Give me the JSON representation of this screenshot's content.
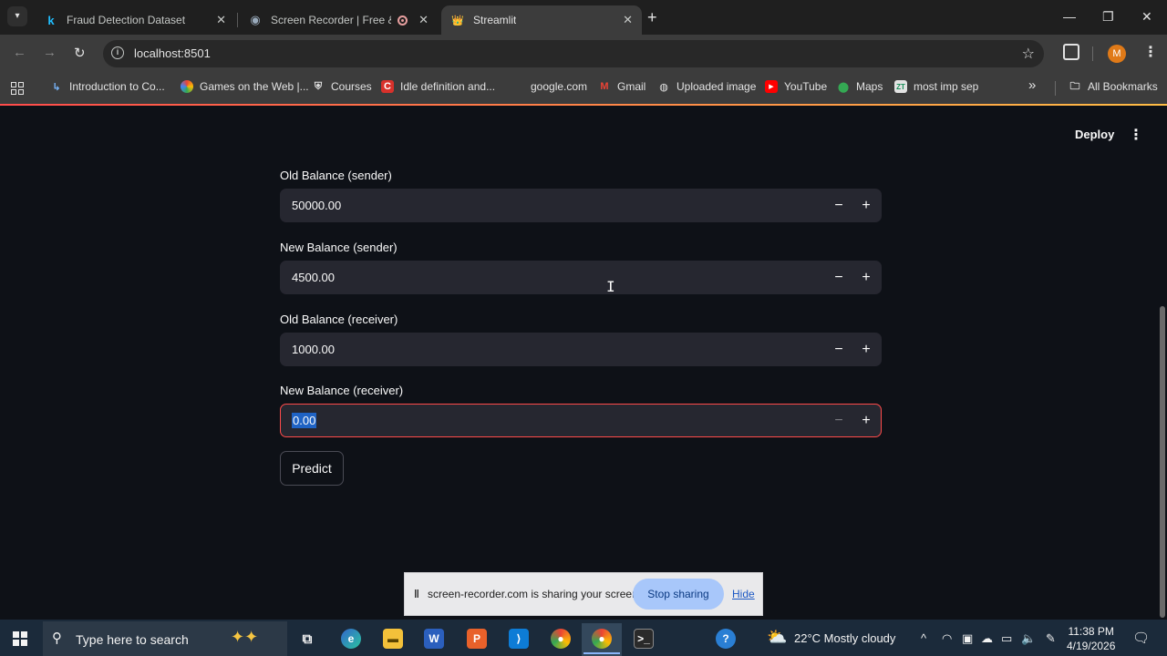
{
  "browser": {
    "tabs": [
      {
        "title": "Fraud Detection Dataset",
        "icon": "kaggle-icon"
      },
      {
        "title": "Screen Recorder | Free & O",
        "icon": "screen-recorder-icon"
      },
      {
        "title": "Streamlit",
        "icon": "streamlit-icon"
      }
    ],
    "url": "localhost:8501",
    "profile_initial": "M",
    "bookmarks": [
      "Introduction to Co...",
      "Games on the Web |...",
      "Courses",
      "Idle definition and...",
      "google.com",
      "Gmail",
      "Uploaded image",
      "YouTube",
      "Maps",
      "most imp sep"
    ],
    "all_bookmarks": "All Bookmarks"
  },
  "app": {
    "deploy_label": "Deploy",
    "fields": [
      {
        "label": "Old Balance (sender)",
        "value": "50000.00"
      },
      {
        "label": "New Balance (sender)",
        "value": "4500.00"
      },
      {
        "label": "Old Balance (receiver)",
        "value": "1000.00"
      },
      {
        "label": "New Balance (receiver)",
        "value": "0.00"
      }
    ],
    "predict_label": "Predict"
  },
  "share_bar": {
    "message": "screen-recorder.com is sharing your screen.",
    "stop_label": "Stop sharing",
    "hide_label": "Hide"
  },
  "taskbar": {
    "search_placeholder": "Type here to search",
    "weather": "22°C  Mostly cloudy",
    "time": "11:38 PM",
    "date": "4/19/2026"
  },
  "colors": {
    "page_bg": "#0e1117",
    "input_bg": "#262730",
    "focus_border": "#ff4b4b",
    "stop_button": "#a8c7fa"
  }
}
